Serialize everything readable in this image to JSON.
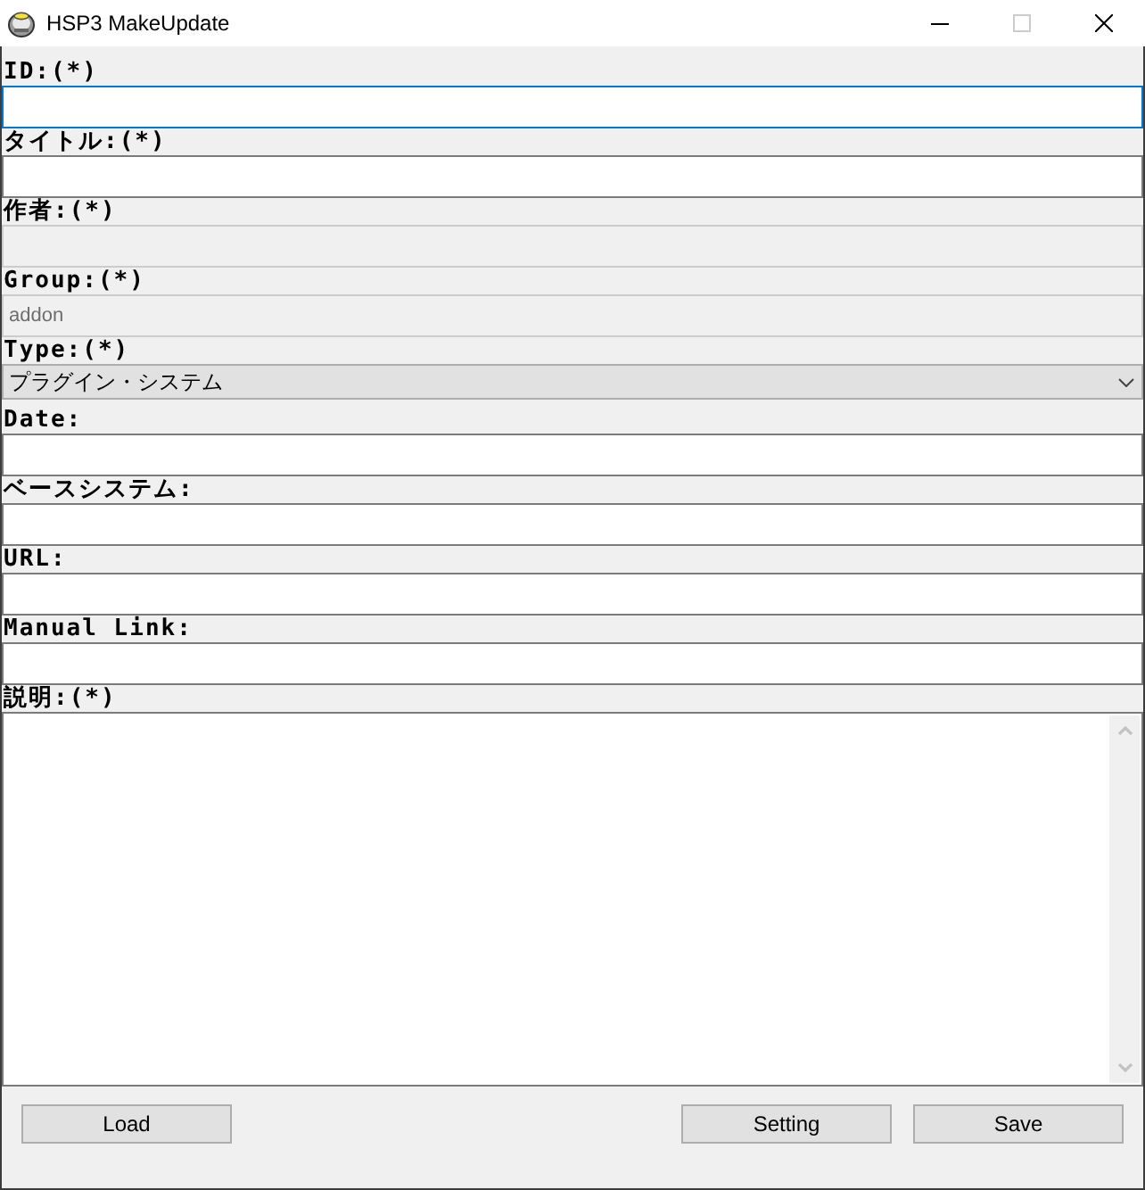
{
  "window": {
    "title": "HSP3 MakeUpdate",
    "maximize_disabled": true
  },
  "fields": [
    {
      "kind": "text",
      "label": "ID:(*)",
      "focused": true,
      "disabled": false
    },
    {
      "kind": "text",
      "label": "タイトル:(*)",
      "focused": false,
      "disabled": false
    },
    {
      "kind": "text",
      "label": "作者:(*)",
      "focused": false,
      "disabled": true
    },
    {
      "kind": "text",
      "label": "Group:(*)",
      "value": "addon",
      "focused": false,
      "disabled": true
    },
    {
      "kind": "select",
      "label": "Type:(*)",
      "value": "プラグイン・システム"
    },
    {
      "kind": "text",
      "label": "Date:",
      "focused": false,
      "disabled": false
    },
    {
      "kind": "text",
      "label": "ベースシステム:",
      "focused": false,
      "disabled": false
    },
    {
      "kind": "text",
      "label": "URL:",
      "focused": false,
      "disabled": false
    },
    {
      "kind": "text",
      "label": "Manual Link:",
      "focused": false,
      "disabled": false
    },
    {
      "kind": "textarea",
      "label": "説明:(*)"
    }
  ],
  "buttons_left": [
    {
      "label": "Load"
    }
  ],
  "buttons_right": [
    {
      "label": "Setting"
    },
    {
      "label": "Save"
    }
  ]
}
